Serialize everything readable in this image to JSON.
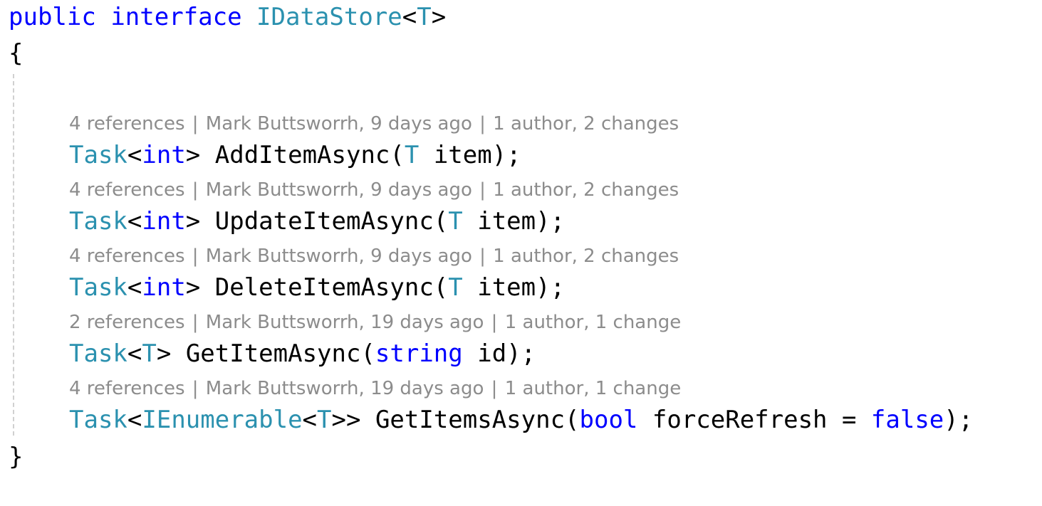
{
  "colors": {
    "keyword": "#0000ff",
    "type": "#2b91af",
    "plain": "#000000",
    "codelens": "#8c8c8c",
    "guide": "#d0d0d0",
    "background": "#ffffff"
  },
  "header": {
    "public": "public",
    "interface": "interface",
    "name": "IDataStore",
    "open_angle": "<",
    "type_param": "T",
    "close_angle": ">"
  },
  "open_brace": "{",
  "close_brace": "}",
  "separator": "|",
  "members": [
    {
      "lens": {
        "references": "4 references",
        "author": "Mark Buttsworrh, 9 days ago",
        "changes": "1 author, 2 changes"
      },
      "ret_type": "Task",
      "lt": "<",
      "ret_arg": "int",
      "gt": "> ",
      "method": "AddItemAsync(",
      "param_type": "T",
      "param": " item);"
    },
    {
      "lens": {
        "references": "4 references",
        "author": "Mark Buttsworrh, 9 days ago",
        "changes": "1 author, 2 changes"
      },
      "ret_type": "Task",
      "lt": "<",
      "ret_arg": "int",
      "gt": "> ",
      "method": "UpdateItemAsync(",
      "param_type": "T",
      "param": " item);"
    },
    {
      "lens": {
        "references": "4 references",
        "author": "Mark Buttsworrh, 9 days ago",
        "changes": "1 author, 2 changes"
      },
      "ret_type": "Task",
      "lt": "<",
      "ret_arg": "int",
      "gt": "> ",
      "method": "DeleteItemAsync(",
      "param_type": "T",
      "param": " item);"
    },
    {
      "lens": {
        "references": "2 references",
        "author": "Mark Buttsworrh, 19 days ago",
        "changes": "1 author, 1 change"
      },
      "ret_type": "Task",
      "lt": "<",
      "ret_arg": "T",
      "gt": "> ",
      "method": "GetItemAsync(",
      "param_type": "string",
      "param": " id);"
    },
    {
      "lens": {
        "references": "4 references",
        "author": "Mark Buttsworrh, 19 days ago",
        "changes": "1 author, 1 change"
      },
      "ret_type": "Task",
      "lt": "<",
      "ret_arg": "IEnumerable",
      "ret_arg_lt": "<",
      "ret_arg_inner": "T",
      "gt": ">> ",
      "method": "GetItemsAsync(",
      "param_type": "bool",
      "param": " forceRefresh = ",
      "default_kw": "false",
      "tail": ");"
    }
  ]
}
